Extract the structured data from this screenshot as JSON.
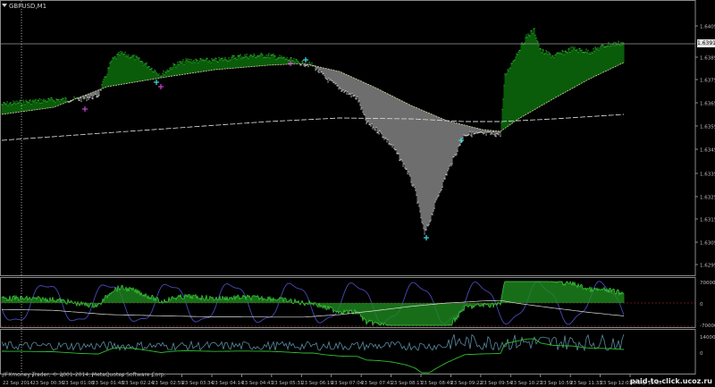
{
  "window": {
    "title": "GBPUSD,M1"
  },
  "price_axis": {
    "current_price": "1.6391",
    "labels": [
      "1.6405",
      "1.6385",
      "1.6375",
      "1.6365",
      "1.6355",
      "1.6345",
      "1.6335",
      "1.6325",
      "1.6315",
      "1.6305",
      "1.6295"
    ]
  },
  "indicator1": {
    "labels": [
      "7000000",
      "0",
      "-7000000"
    ]
  },
  "indicator2": {
    "labels": [
      "14000000",
      "0"
    ]
  },
  "time_axis": {
    "labels": [
      "22 Sep 2014",
      "23 Sep 00:36",
      "23 Sep 01:08",
      "23 Sep 01:48",
      "23 Sep 02:24",
      "23 Sep 02:59",
      "23 Sep 03:34",
      "23 Sep 04:14",
      "23 Sep 04:47",
      "23 Sep 05:31",
      "23 Sep 06:19",
      "23 Sep 07:04",
      "23 Sep 07:41",
      "23 Sep 08:17",
      "23 Sep 08:49",
      "23 Sep 09:22",
      "23 Sep 09:54",
      "23 Sep 10:27",
      "23 Sep 10:59",
      "23 Sep 11:33",
      "23 Sep 12:07",
      "23 Sep 12:39"
    ]
  },
  "footer": {
    "copyright": "IFXmoney Trader, © 2001-2014, MetaQuotes Software Corp.",
    "watermark": "paid-to-click.ucoz.ru"
  },
  "colors": {
    "bull_fill": "#0a5d0a",
    "bull_line": "#2db52d",
    "bear_fill": "#6e6e6e",
    "bear_line": "#cfcfcf",
    "grid": "#555555",
    "oscillator": "#4a4ab8",
    "marker_magenta": "#cc44cc",
    "marker_cyan": "#44dddd"
  }
}
